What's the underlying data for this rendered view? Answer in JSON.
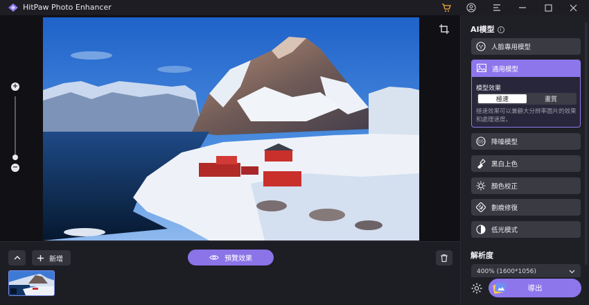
{
  "window": {
    "title": "HitPaw Photo Enhancer",
    "controls": [
      "cart-icon",
      "account-icon",
      "menu-icon",
      "minimize-icon",
      "maximize-icon",
      "close-icon"
    ]
  },
  "canvas": {
    "zoom_in": "+",
    "zoom_out": "−",
    "zoom_level": 0.1
  },
  "bottom": {
    "add_label": "新增",
    "preview_label": "預覽效果"
  },
  "side": {
    "ai_model_title": "AI模型",
    "models": [
      {
        "label": "人臉專用模型",
        "icon": "face-icon"
      },
      {
        "label": "通用模型",
        "icon": "image-icon",
        "active": true
      },
      {
        "label": "降噪模型",
        "icon": "denoise-icon"
      },
      {
        "label": "黑白上色",
        "icon": "colorize-icon"
      },
      {
        "label": "顏色校正",
        "icon": "sun-icon"
      },
      {
        "label": "劃痕修復",
        "icon": "scratch-icon"
      },
      {
        "label": "低光模式",
        "icon": "contrast-icon"
      }
    ],
    "effect_label": "模型效果",
    "effect_options": [
      "極速",
      "畫質"
    ],
    "effect_selected": "極速",
    "effect_desc": "極速效果可以兼顧大分辨率圖片的效果和處理速度。",
    "resolution_title": "解析度",
    "resolution_value": "400% (1600*1056)",
    "export_label": "導出"
  },
  "colors": {
    "accent": "#8d76ec",
    "panel": "#1f1f26",
    "button": "#3a3a43"
  }
}
